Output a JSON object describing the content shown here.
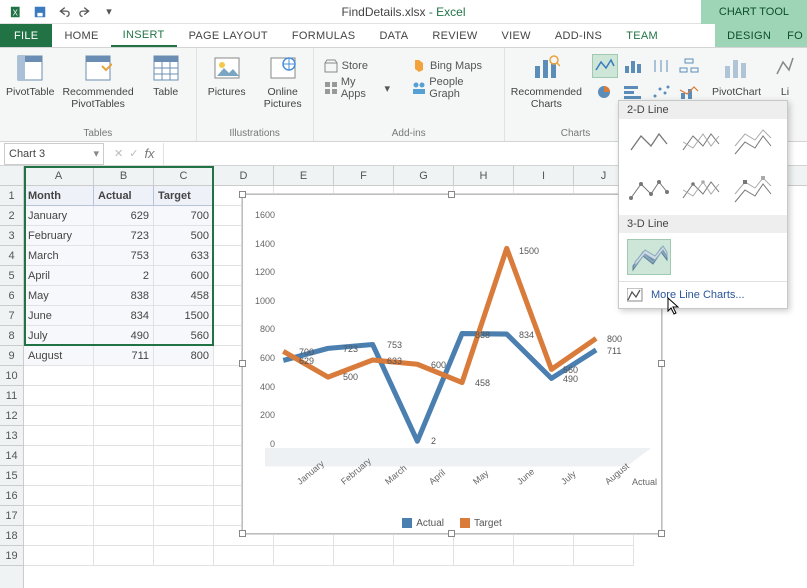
{
  "title": {
    "doc": "FindDetails.xlsx",
    "app": "Excel",
    "contextual": "CHART TOOL"
  },
  "tabs": {
    "file": "FILE",
    "home": "HOME",
    "insert": "INSERT",
    "pagelayout": "PAGE LAYOUT",
    "formulas": "FORMULAS",
    "data": "DATA",
    "review": "REVIEW",
    "view": "VIEW",
    "addins": "ADD-INS",
    "team": "TEAM",
    "design": "DESIGN",
    "fo": "FO"
  },
  "ribbon": {
    "groups": {
      "tables": "Tables",
      "illustrations": "Illustrations",
      "addins": "Add-ins",
      "charts": "Charts"
    },
    "pivottable": "PivotTable",
    "recpivot": "Recommended\nPivotTables",
    "table": "Table",
    "pictures": "Pictures",
    "onlinepics": "Online\nPictures",
    "store": "Store",
    "myapps": "My Apps",
    "bingmaps": "Bing Maps",
    "peoplegraph": "People Graph",
    "reccharts": "Recommended\nCharts",
    "pivotchart": "PivotChart",
    "li": "Li"
  },
  "linechart_dropdown": {
    "sec2d": "2-D Line",
    "sec3d": "3-D Line",
    "more": "More Line Charts..."
  },
  "namebox": "Chart 3",
  "columns": [
    "A",
    "B",
    "C",
    "D",
    "E",
    "F",
    "G",
    "H",
    "I",
    "J"
  ],
  "rows": [
    1,
    2,
    3,
    4,
    5,
    6,
    7,
    8,
    9,
    10,
    11,
    12,
    13,
    14,
    15,
    16,
    17,
    18,
    19
  ],
  "table": {
    "headers": {
      "month": "Month",
      "actual": "Actual",
      "target": "Target"
    },
    "rows": [
      {
        "month": "January",
        "actual": 629,
        "target": 700
      },
      {
        "month": "February",
        "actual": 723,
        "target": 500
      },
      {
        "month": "March",
        "actual": 753,
        "target": 633
      },
      {
        "month": "April",
        "actual": 2,
        "target": 600
      },
      {
        "month": "May",
        "actual": 838,
        "target": 458
      },
      {
        "month": "June",
        "actual": 834,
        "target": 1500
      },
      {
        "month": "July",
        "actual": 490,
        "target": 560
      },
      {
        "month": "August",
        "actual": 711,
        "target": 800
      }
    ]
  },
  "chart_data": {
    "type": "line",
    "categories": [
      "January",
      "February",
      "March",
      "April",
      "May",
      "June",
      "July",
      "August"
    ],
    "series": [
      {
        "name": "Actual",
        "values": [
          629,
          723,
          753,
          2,
          838,
          834,
          490,
          711
        ],
        "color": "#4a7fb0"
      },
      {
        "name": "Target",
        "values": [
          700,
          500,
          633,
          600,
          458,
          1500,
          560,
          800
        ],
        "color": "#d97b3a"
      }
    ],
    "ylim": [
      0,
      1600
    ],
    "yticks": [
      0,
      200,
      400,
      600,
      800,
      1000,
      1200,
      1400,
      1600
    ],
    "category_axis_label": "Actual",
    "data_labels": [
      "629",
      "723",
      "753",
      "2",
      "838",
      "834",
      "490",
      "711",
      "700",
      "500",
      "633",
      "600",
      "458",
      "1500",
      "560",
      "800"
    ],
    "legend": [
      "Actual",
      "Target"
    ]
  }
}
